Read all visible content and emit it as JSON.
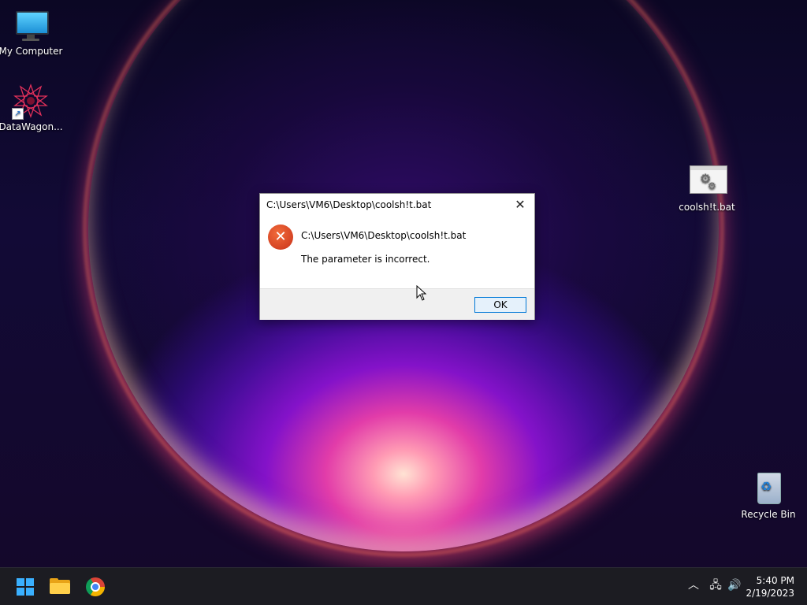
{
  "desktop": {
    "icons": [
      {
        "label": "My Computer",
        "icon": "computer-icon"
      },
      {
        "label": "DataWagon...",
        "icon": "datawagon-shortcut-icon"
      },
      {
        "label": "coolsh!t.bat",
        "icon": "batch-file-icon"
      },
      {
        "label": "Recycle Bin",
        "icon": "recycle-bin-icon"
      }
    ]
  },
  "dialog": {
    "title": "C:\\Users\\VM6\\Desktop\\coolsh!t.bat",
    "close_glyph": "✕",
    "error_glyph": "✕",
    "path": "C:\\Users\\VM6\\Desktop\\coolsh!t.bat",
    "message": "The parameter is incorrect.",
    "ok_label": "OK"
  },
  "taskbar": {
    "pinned": [
      "start-button",
      "file-explorer",
      "chrome"
    ],
    "tray": {
      "chevron_glyph": "︿",
      "network_glyph": "🖧",
      "volume_glyph": "🔊"
    },
    "clock": {
      "time": "5:40 PM",
      "date": "2/19/2023"
    }
  },
  "colors": {
    "accent": "#0078d7",
    "error": "#d9431f",
    "taskbar": "#1c1c22"
  }
}
